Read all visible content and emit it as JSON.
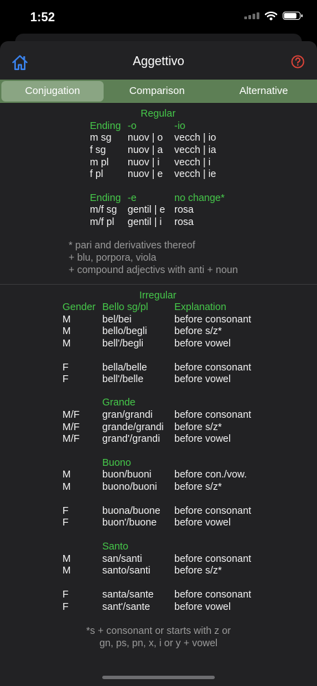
{
  "status": {
    "time": "1:52"
  },
  "nav": {
    "title": "Aggettivo",
    "home_icon": "home-icon",
    "help_icon": "help-icon"
  },
  "colors": {
    "accent_green": "#46c84a",
    "segment_bar": "#5d7f55",
    "icon_blue": "#3a84f0",
    "icon_red": "#e0453a"
  },
  "tabs": [
    {
      "label": "Conjugation",
      "active": true
    },
    {
      "label": "Comparison",
      "active": false
    },
    {
      "label": "Alternative",
      "active": false
    }
  ],
  "regular": {
    "title": "Regular",
    "table1": {
      "headers": [
        "Ending",
        "-o",
        "-io"
      ],
      "rows": [
        [
          "m sg",
          "nuov | o",
          "vecch | io"
        ],
        [
          "f sg",
          "nuov | a",
          "vecch | ia"
        ],
        [
          "m pl",
          "nuov | i",
          "vecch | i"
        ],
        [
          "f pl",
          "nuov | e",
          "vecch | ie"
        ]
      ]
    },
    "table2": {
      "headers": [
        "Ending",
        "-e",
        "no change*"
      ],
      "rows": [
        [
          "m/f sg",
          "gentil | e",
          "rosa"
        ],
        [
          "m/f pl",
          "gentil | i",
          "rosa"
        ]
      ]
    },
    "notes": [
      "* pari and derivatives thereof",
      "+ blu, porpora, viola",
      "+ compound adjectivs with anti + noun"
    ]
  },
  "irregular": {
    "title": "Irregular",
    "headers": [
      "Gender",
      "Bello sg/pl",
      "Explanation"
    ],
    "bello_rows": [
      [
        "M",
        "bel/bei",
        "before consonant"
      ],
      [
        "M",
        "bello/begli",
        "before s/z*"
      ],
      [
        "M",
        "bell'/begli",
        "before vowel"
      ],
      [
        "F",
        "bella/belle",
        "before consonant"
      ],
      [
        "F",
        "bell'/belle",
        "before vowel"
      ]
    ],
    "grande": {
      "title": "Grande",
      "rows": [
        [
          "M/F",
          "gran/grandi",
          "before consonant"
        ],
        [
          "M/F",
          "grande/grandi",
          "before s/z*"
        ],
        [
          "M/F",
          "grand'/grandi",
          "before vowel"
        ]
      ]
    },
    "buono": {
      "title": "Buono",
      "rows": [
        [
          "M",
          "buon/buoni",
          "before con./vow."
        ],
        [
          "M",
          "buono/buoni",
          "before s/z*"
        ],
        [
          "F",
          "buona/buone",
          "before consonant"
        ],
        [
          "F",
          "buon'/buone",
          "before vowel"
        ]
      ]
    },
    "santo": {
      "title": "Santo",
      "rows": [
        [
          "M",
          "san/santi",
          "before consonant"
        ],
        [
          "M",
          "santo/santi",
          "before s/z*"
        ],
        [
          "F",
          "santa/sante",
          "before consonant"
        ],
        [
          "F",
          "sant'/sante",
          "before vowel"
        ]
      ]
    },
    "footnote": [
      "*s + consonant or starts with z or",
      "gn, ps, pn, x, i or y + vowel"
    ]
  }
}
